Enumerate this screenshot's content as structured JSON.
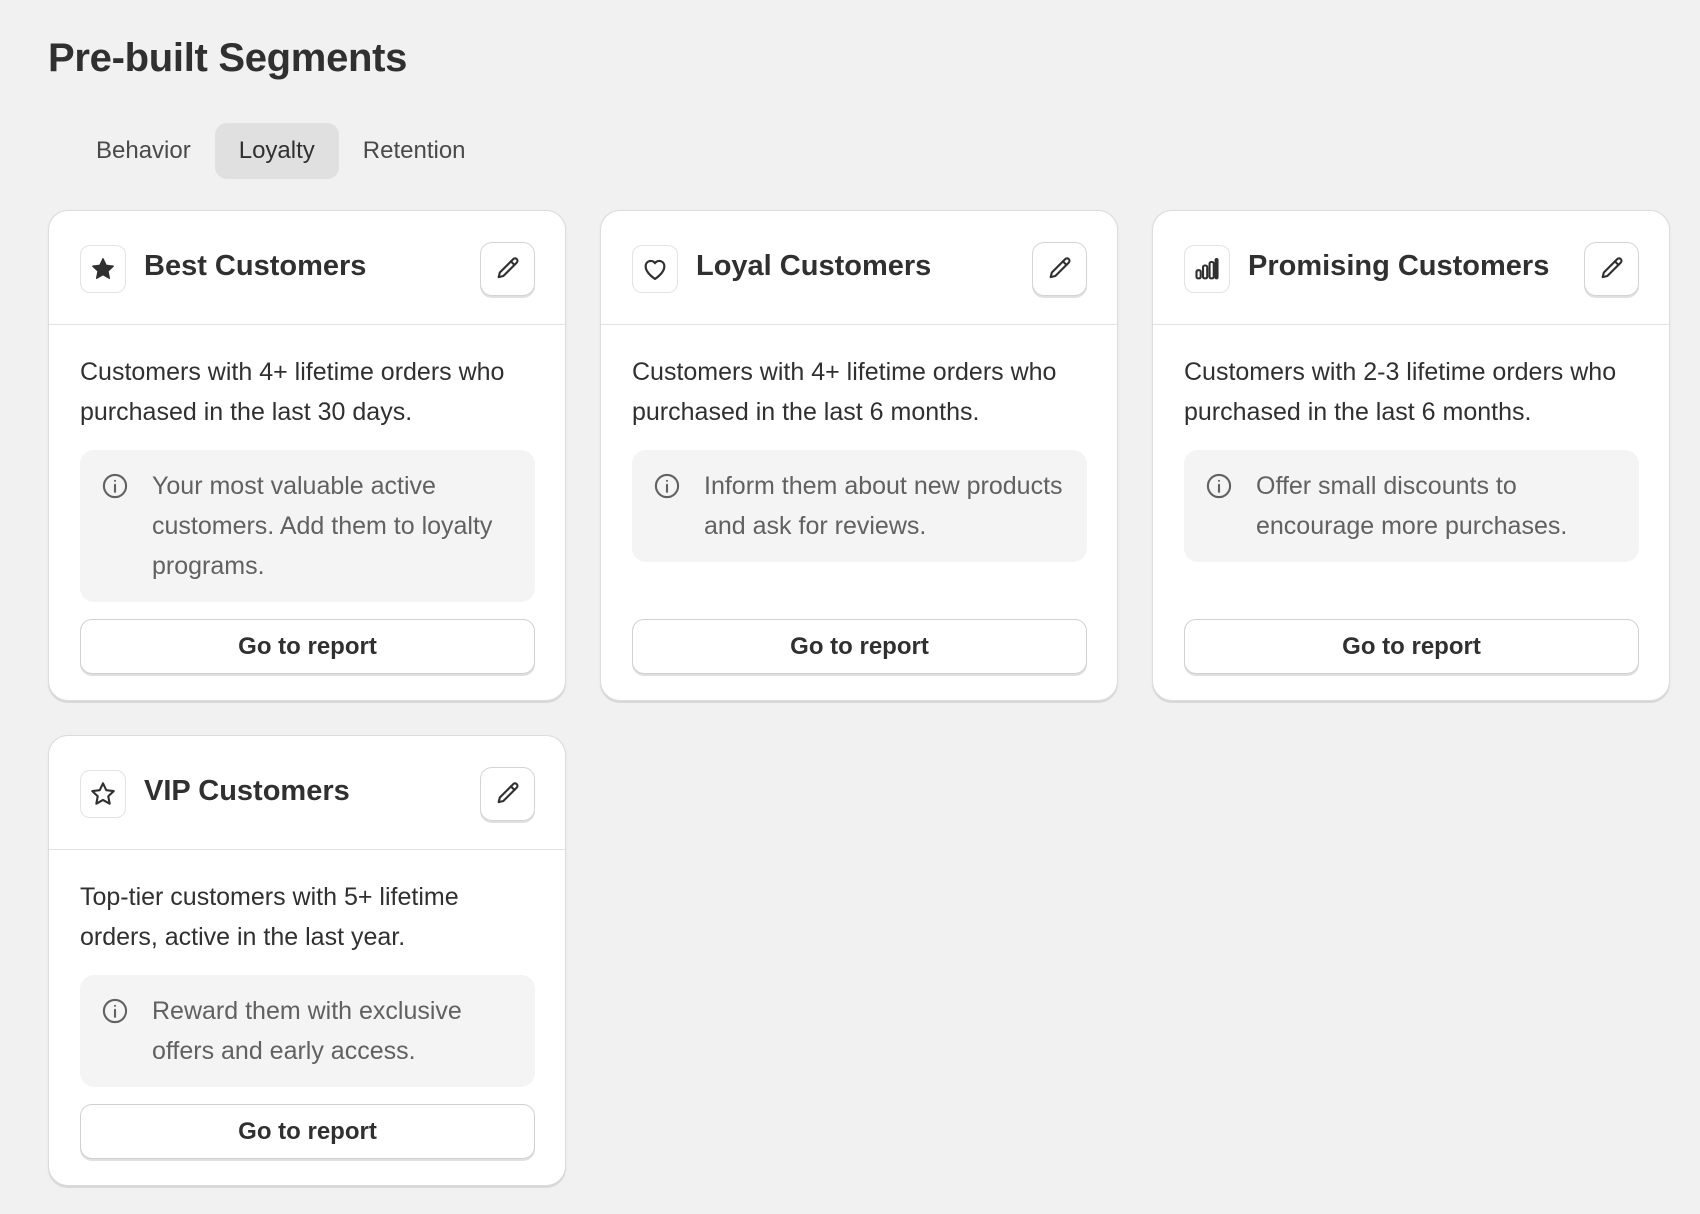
{
  "page": {
    "title": "Pre-built Segments"
  },
  "tabs": [
    {
      "label": "Behavior",
      "active": false
    },
    {
      "label": "Loyalty",
      "active": true
    },
    {
      "label": "Retention",
      "active": false
    }
  ],
  "cards": [
    {
      "icon": "star-filled-icon",
      "title": "Best Customers",
      "description": "Customers with 4+ lifetime orders who purchased in the last 30 days.",
      "tip": "Your most valuable active customers. Add them to loyalty programs.",
      "button": "Go to report"
    },
    {
      "icon": "heart-icon",
      "title": "Loyal Customers",
      "description": "Customers with 4+ lifetime orders who purchased in the last 6 months.",
      "tip": "Inform them about new products and ask for reviews.",
      "button": "Go to report"
    },
    {
      "icon": "bar-chart-icon",
      "title": "Promising Customers",
      "description": "Customers with 2-3 lifetime orders who purchased in the last 6 months.",
      "tip": "Offer small discounts to encourage more purchases.",
      "button": "Go to report"
    },
    {
      "icon": "star-outline-icon",
      "title": "VIP Customers",
      "description": "Top-tier customers with 5+ lifetime orders, active in the last year.",
      "tip": "Reward them with exclusive offers and early access.",
      "button": "Go to report"
    }
  ],
  "colors": {
    "background": "#f1f1f1",
    "card": "#ffffff",
    "text": "#303030",
    "muted_text": "#616161",
    "active_tab": "#e0e0e0"
  }
}
